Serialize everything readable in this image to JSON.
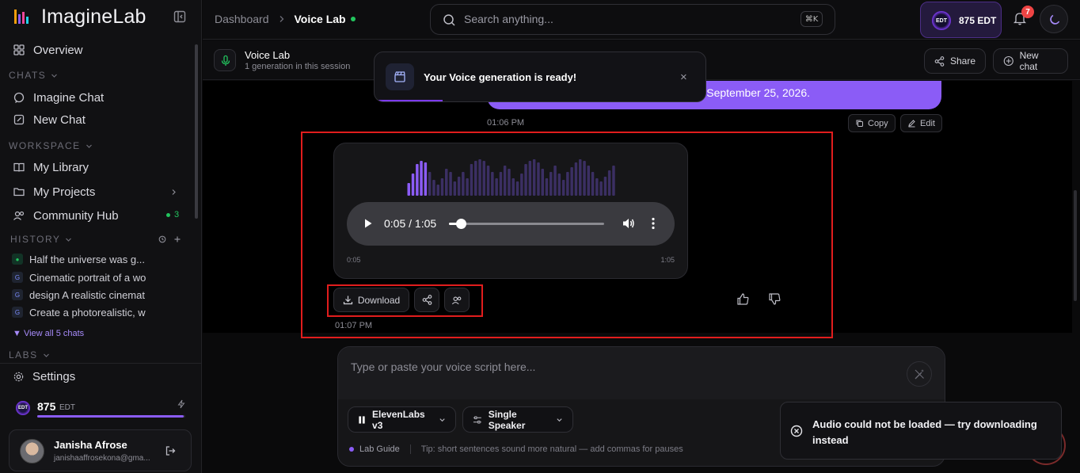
{
  "brand": {
    "name": "ImagineLab"
  },
  "sidebar": {
    "overview": "Overview",
    "sections": {
      "chats": "CHATS",
      "workspace": "WORKSPACE",
      "history": "HISTORY",
      "labs": "LABS"
    },
    "chats": [
      "Imagine Chat",
      "New Chat"
    ],
    "workspace": [
      "My Library",
      "My Projects",
      "Community Hub"
    ],
    "community_count": "3",
    "history": [
      "Half the universe was g...",
      "Cinematic portrait of a wo",
      "design A realistic cinemat",
      "Create a photorealistic, w"
    ],
    "view_all": "View all 5 chats",
    "settings": "Settings",
    "credits": {
      "amount": "875",
      "unit": "EDT",
      "fill_fraction": 0.99
    },
    "user": {
      "name": "Janisha Afrose",
      "email": "janishaaffrosekona@gma..."
    }
  },
  "topbar": {
    "breadcrumb_root": "Dashboard",
    "breadcrumb_current": "Voice Lab",
    "search_placeholder": "Search anything...",
    "shortcut": "⌘K",
    "edt_badge": "875 EDT",
    "coin_label": "EDT",
    "notifications": "7"
  },
  "session": {
    "title": "Voice Lab",
    "subtitle": "1 generation in this session",
    "share": "Share",
    "new_chat": "New chat"
  },
  "toast": {
    "message": "Your Voice generation is ready!",
    "close": "×"
  },
  "messages": {
    "user_text": "s September 25, 2026.",
    "user_time": "01:06 PM",
    "copy": "Copy",
    "edit": "Edit",
    "audio": {
      "current_time": "0:05 / 1:05",
      "progress_fraction": 0.077,
      "label_start": "0:05",
      "label_end": "1:05",
      "download": "Download",
      "time": "01:07 PM"
    }
  },
  "composer": {
    "placeholder": "Type or paste your voice script here...",
    "model": "ElevenLabs v3",
    "speaker": "Single Speaker",
    "guide": "Lab Guide",
    "tip": "Tip: short sentences sound more natural — add commas for pauses"
  },
  "error_toast": {
    "message": "Audio could not be loaded — try downloading instead"
  },
  "colors": {
    "accent": "#8b5cf6",
    "highlight": "#e11d1d",
    "success": "#22c55e",
    "danger": "#ef4444"
  },
  "icons": [
    "logo-icon",
    "collapse-sidebar-icon",
    "grid-icon",
    "chat-icon",
    "edit-icon",
    "book-icon",
    "folder-icon",
    "users-icon",
    "history-icon",
    "plus-icon",
    "gear-icon",
    "bolt-icon",
    "logout-icon",
    "search-icon",
    "bell-icon",
    "moon-icon",
    "mic-icon",
    "share-icon",
    "plus-circle-icon",
    "clapperboard-icon",
    "close-icon",
    "copy-icon",
    "pencil-icon",
    "play-icon",
    "volume-icon",
    "more-vertical-icon",
    "download-icon",
    "users-icon",
    "thumbs-up-icon",
    "thumbs-down-icon",
    "magic-wand-icon",
    "bars-icon",
    "sliders-icon",
    "chevron-down-icon",
    "x-circle-icon"
  ]
}
